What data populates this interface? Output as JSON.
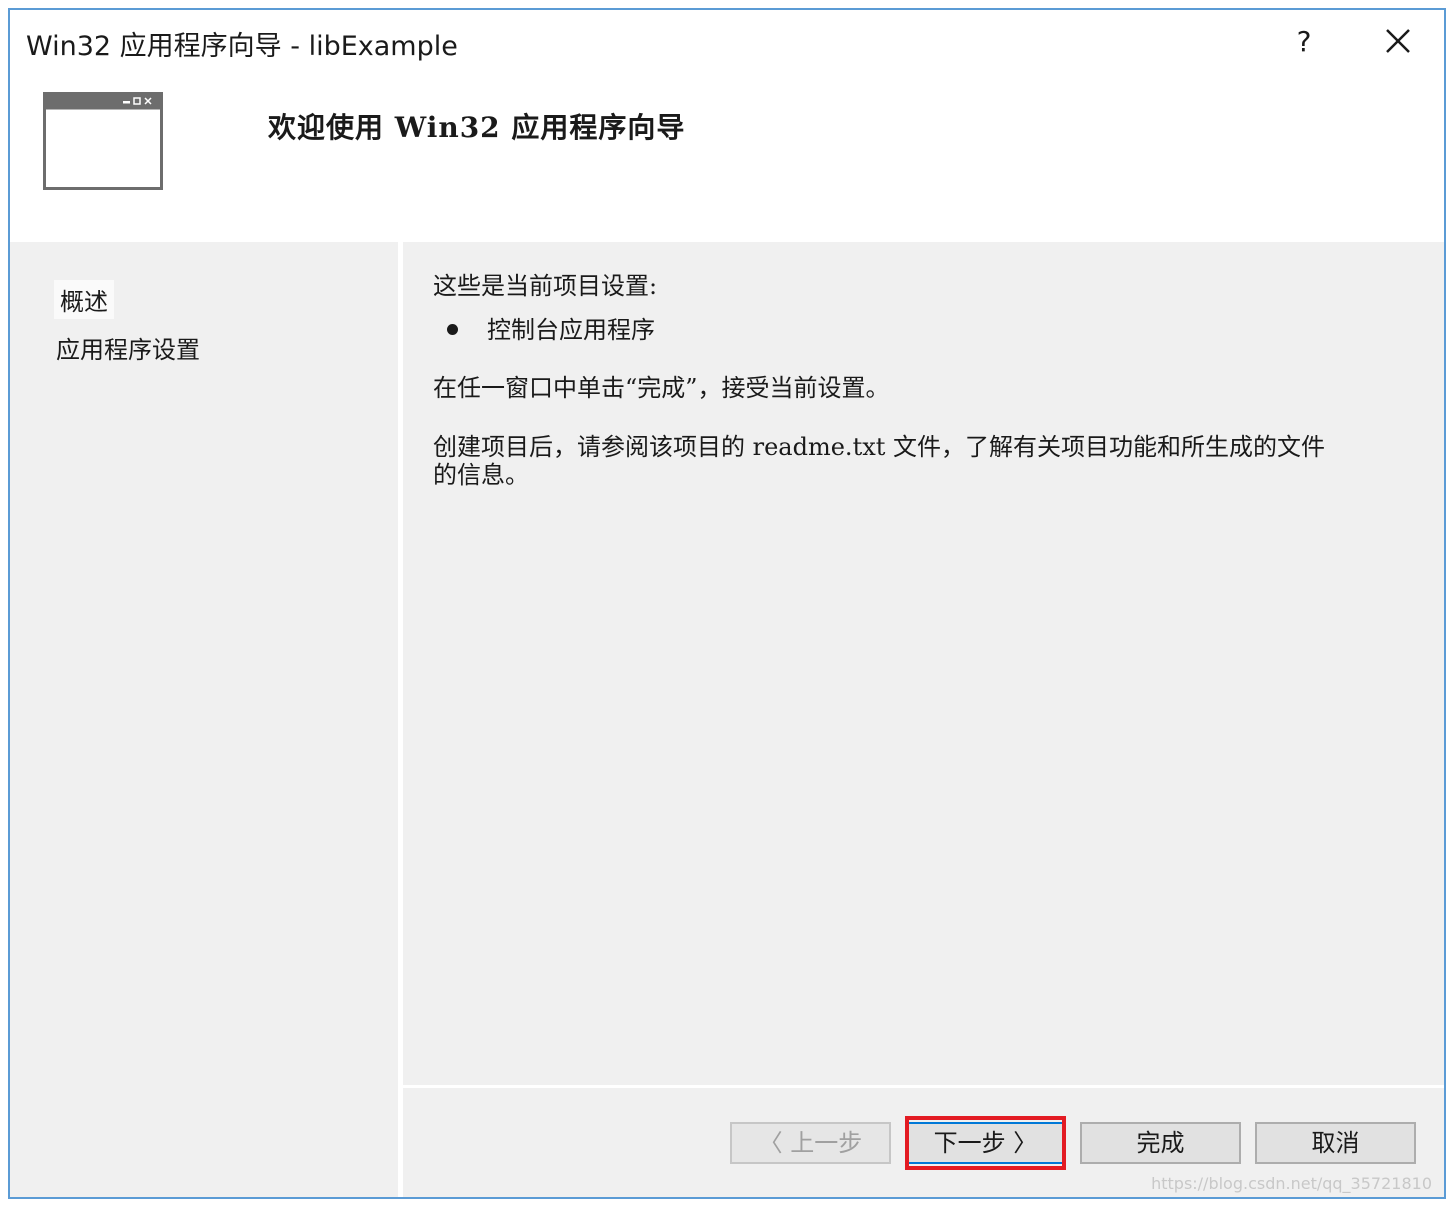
{
  "window": {
    "title": "Win32 应用程序向导 - libExample",
    "help_label": "?"
  },
  "header": {
    "title": "欢迎使用 Win32 应用程序向导"
  },
  "nav": {
    "items": [
      {
        "label": "概述",
        "selected": true
      },
      {
        "label": "应用程序设置",
        "selected": false
      }
    ]
  },
  "content": {
    "intro": "这些是当前项目设置:",
    "bullets": [
      "控制台应用程序"
    ],
    "para1": "在任一窗口中单击“完成”，接受当前设置。",
    "para2_line1": "创建项目后，请参阅该项目的 readme.txt 文件，了解有关项目功能和所生成的文件",
    "para2_line2": "的信息。"
  },
  "buttons": {
    "prev": "〈 上一步",
    "next": "下一步 〉",
    "finish": "完成",
    "cancel": "取消"
  },
  "watermark": "https://blog.csdn.net/qq_35721810",
  "colors": {
    "accent_border": "#5b9bd5",
    "pane_bg": "#f0f0f0",
    "highlight": "#e31b23"
  }
}
